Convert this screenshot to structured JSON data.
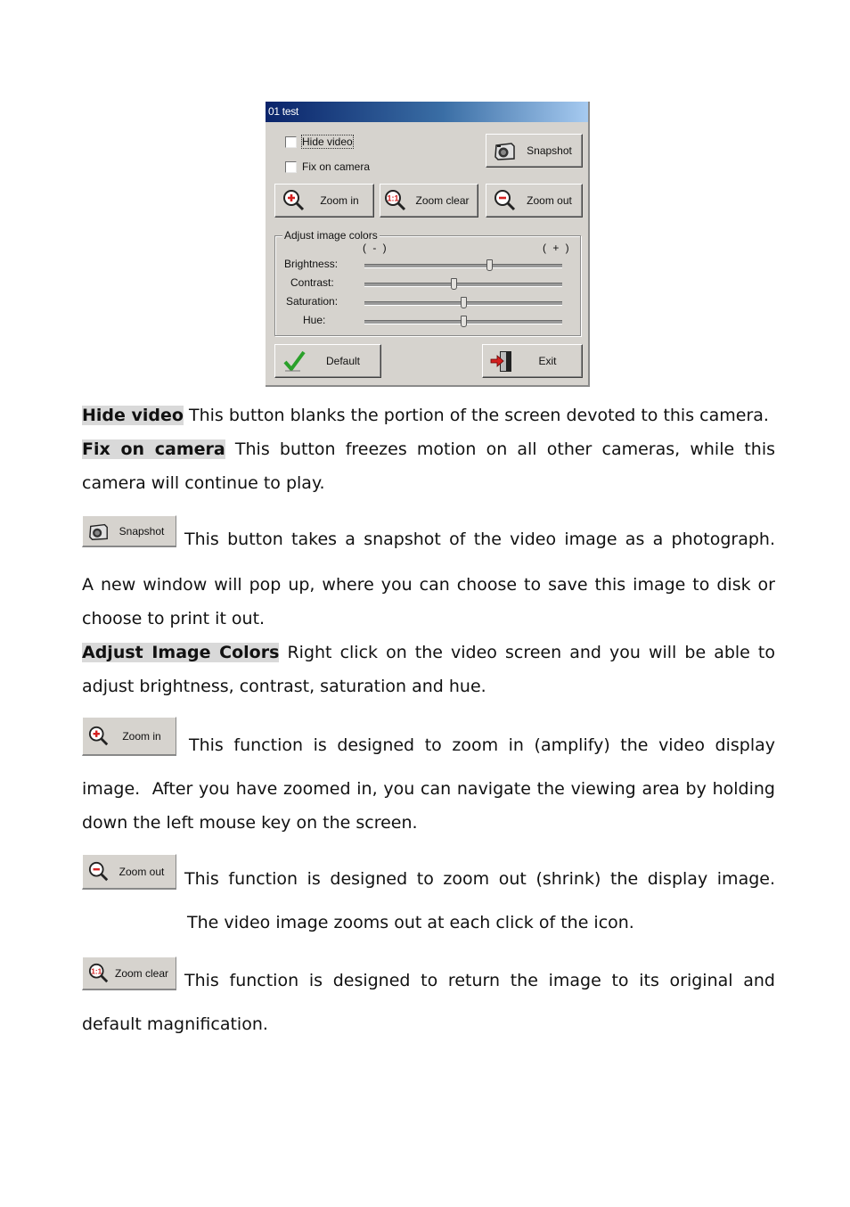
{
  "dialog": {
    "title": "01 test",
    "checkboxes": [
      {
        "label": "Hide video",
        "checked": false
      },
      {
        "label": "Fix on camera",
        "checked": false
      }
    ],
    "buttons": {
      "snapshot": "Snapshot",
      "zoom_in": "Zoom in",
      "zoom_clear": "Zoom clear",
      "zoom_out": "Zoom out",
      "default": "Default",
      "exit": "Exit"
    },
    "group": {
      "legend": "Adjust image colors",
      "minus": "( - )",
      "plus": "( + )",
      "sliders": [
        {
          "label": "Brightness:",
          "value": 0.63
        },
        {
          "label": "Contrast:",
          "value": 0.45
        },
        {
          "label": "Saturation:",
          "value": 0.5
        },
        {
          "label": "Hue:",
          "value": 0.5
        }
      ]
    },
    "colors": {
      "face": "#d6d3ce",
      "title_start": "#0a246a",
      "title_end": "#a6caf0",
      "accent_red": "#d42020",
      "check_green": "#2aa02a"
    }
  },
  "doc": {
    "hide_video": {
      "term": "Hide video",
      "text": " This button blanks the portion of the screen devoted to this camera."
    },
    "fix_on_camera": {
      "term": "Fix on camera",
      "text": " This button freezes motion on all other cameras, while this camera will continue to play."
    },
    "snapshot": {
      "button": "Snapshot",
      "text1": "This button takes a snapshot of the video image as a photograph.",
      "text2": "A new window will pop up, where you can choose to save this image to disk or choose to print it out."
    },
    "adjust": {
      "term": "Adjust Image Colors",
      "text": " Right click on the video screen and you will be able to adjust brightness, contrast, saturation and hue."
    },
    "zoom_in": {
      "button": "Zoom in",
      "text1": "This function is designed to zoom in (amplify) the video display",
      "text2": "image.  After you have zoomed in, you can navigate the viewing area by holding down the left mouse key on the screen."
    },
    "zoom_out": {
      "button": "Zoom out",
      "text1": "This function is designed to zoom out (shrink) the display image.",
      "text2": "The video image zooms out at each click of the icon."
    },
    "zoom_clear": {
      "button": "Zoom clear",
      "text1": "This function is designed to return the image to its original and",
      "text2": "default magnification."
    }
  }
}
